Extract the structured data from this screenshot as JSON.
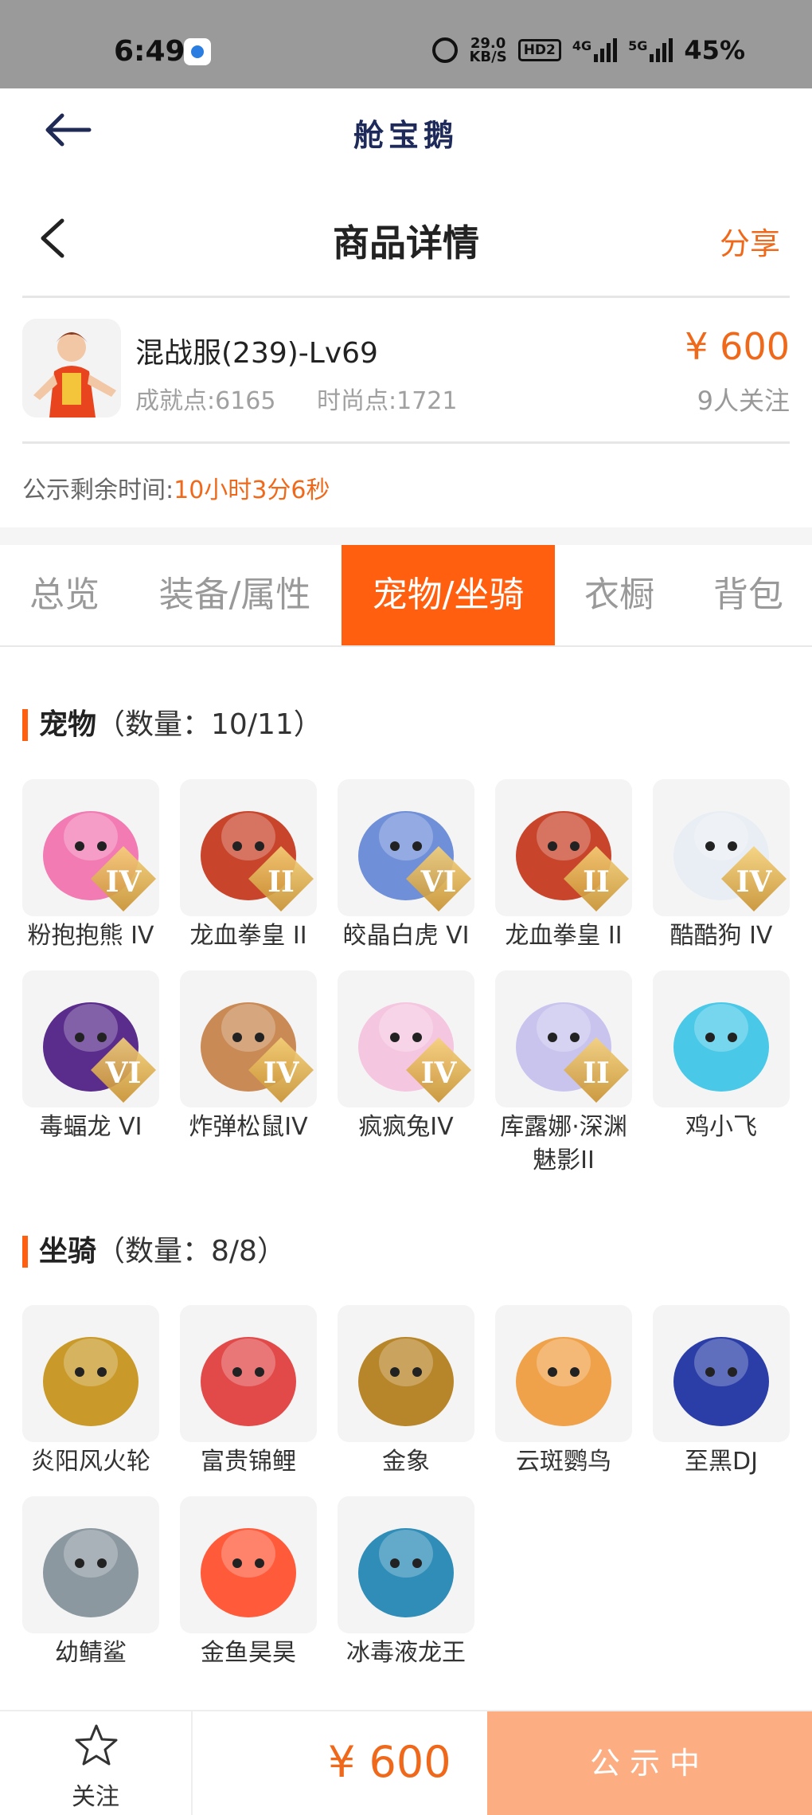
{
  "status_bar": {
    "time": "6:49",
    "speed_value": "29.0",
    "speed_unit": "KB/S",
    "hd": "HD2",
    "network1": "4G",
    "network2": "5G",
    "battery": "45%"
  },
  "app_bar": {
    "title": "舱宝鹅"
  },
  "page": {
    "title": "商品详情",
    "share": "分享"
  },
  "product": {
    "name": "混战服(239)-Lv69",
    "achievement": "成就点:6165",
    "fashion": "时尚点:1721",
    "price": "¥ 600",
    "followers": "9人关注"
  },
  "notice": {
    "label": "公示剩余时间:",
    "timer": "10小时3分6秒"
  },
  "tabs": [
    {
      "label": "总览"
    },
    {
      "label": "装备/属性"
    },
    {
      "label": "宠物/坐骑"
    },
    {
      "label": "衣橱"
    },
    {
      "label": "背包"
    }
  ],
  "pets": {
    "title": "宠物",
    "count": "（数量：10/11）",
    "items": [
      {
        "label": "粉抱抱熊 IV",
        "icon": "pink-bear-icon",
        "badge": "IV",
        "color": "#f27bb4"
      },
      {
        "label": "龙血拳皇 II",
        "icon": "red-beast-icon",
        "badge": "II",
        "color": "#c8452c"
      },
      {
        "label": "皎晶白虎 VI",
        "icon": "white-tiger-icon",
        "badge": "VI",
        "color": "#6f8fd8"
      },
      {
        "label": "龙血拳皇 II",
        "icon": "red-beast-icon",
        "badge": "II",
        "color": "#c8452c"
      },
      {
        "label": "酷酷狗 IV",
        "icon": "cool-dog-icon",
        "badge": "IV",
        "color": "#e9eef4"
      },
      {
        "label": "毒蝠龙 VI",
        "icon": "purple-dragon-icon",
        "badge": "VI",
        "color": "#5a2c8c"
      },
      {
        "label": "炸弹松鼠IV",
        "icon": "squirrel-icon",
        "badge": "IV",
        "color": "#c98a55"
      },
      {
        "label": "疯疯兔IV",
        "icon": "rabbit-icon",
        "badge": "IV",
        "color": "#f4c6df"
      },
      {
        "label": "库露娜·深渊魅影II",
        "icon": "kuluna-icon",
        "badge": "II",
        "color": "#c9c4ee"
      },
      {
        "label": "鸡小飞",
        "icon": "blue-chick-icon",
        "badge": "",
        "color": "#49c8e8"
      }
    ]
  },
  "mounts": {
    "title": "坐骑",
    "count": "（数量：8/8）",
    "items": [
      {
        "label": "炎阳风火轮",
        "icon": "fire-wheel-icon",
        "color": "#c99a2a"
      },
      {
        "label": "富贵锦鲤",
        "icon": "koi-icon",
        "color": "#e24a4a"
      },
      {
        "label": "金象",
        "icon": "golden-elephant-icon",
        "color": "#b8862a"
      },
      {
        "label": "云斑鹦鸟",
        "icon": "parrot-icon",
        "color": "#f0a24a"
      },
      {
        "label": "至黑DJ",
        "icon": "dj-bird-icon",
        "color": "#2b3ea8"
      },
      {
        "label": "幼鲭鲨",
        "icon": "shark-icon",
        "color": "#8c98a0"
      },
      {
        "label": "金鱼昊昊",
        "icon": "goldfish-icon",
        "color": "#ff5a3a"
      },
      {
        "label": "冰毒液龙王",
        "icon": "ice-dragon-icon",
        "color": "#2f8db8"
      }
    ]
  },
  "bottom_bar": {
    "follow_label": "关注",
    "price": "¥ 600",
    "status_button": "公示中"
  },
  "colors": {
    "accent": "#ff5f0f",
    "price": "#f0691b",
    "status_button": "#fcae82"
  }
}
